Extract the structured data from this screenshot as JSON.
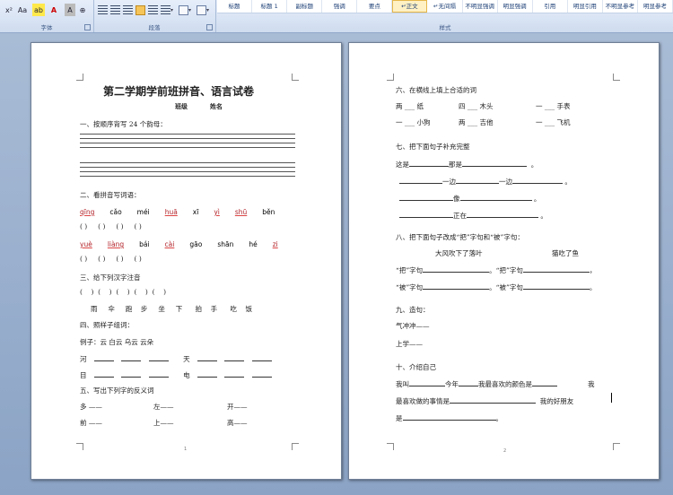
{
  "ribbon": {
    "font_group_label": "字体",
    "para_group_label": "段落",
    "style_group_label": "样式",
    "font_tools": [
      "x²",
      "Aa",
      "ab",
      "A",
      "A",
      "⊕"
    ],
    "styles": [
      "标题",
      "标题 1",
      "副标题",
      "强调",
      "要点",
      "↵正文",
      "↵无间隔",
      "不明显强调",
      "明显强调",
      "引用",
      "明显引用",
      "不明显参考",
      "明显参考"
    ]
  },
  "page1": {
    "title": "第二学期学前班拼音、语言试卷",
    "class_label": "班级",
    "name_label": "姓名",
    "q1": "一、按顺序背写 24 个韵母：",
    "q2": "二、看拼音写词语：",
    "pinyin_row1": [
      "qīng",
      "cǎo",
      "méi",
      "huā",
      "xī",
      "yì",
      "shū",
      "běn"
    ],
    "pinyin_row2": [
      "yuè",
      "liàng",
      "bái",
      "cài",
      "gāo",
      "shān",
      "hé",
      "zi"
    ],
    "paren": "(        )",
    "q3": "三、给下列汉字注音",
    "q3_chars": [
      "雨",
      "伞",
      "跑",
      "步",
      "坐",
      "下",
      "拍",
      "手",
      "吃",
      "饭"
    ],
    "q4": "四、照样子组词：",
    "q4_example": "例子：云  白云  乌云  云朵",
    "q4_chars": [
      "河",
      "天",
      "目",
      "电"
    ],
    "q5": "五、写出下列字的反义词",
    "q5_pairs": [
      "多 ——",
      "左——",
      "开——",
      "前 ——",
      "上——",
      "高——"
    ],
    "page_number": "1"
  },
  "page2": {
    "q6": "六、在横线上填上合适的词",
    "q6_items": [
      "两 ___ 纸",
      "四 ___ 木头",
      "一 ___ 手表",
      "一 ___ 小狗",
      "两 ___ 吉他",
      "一 ___ 飞机"
    ],
    "q7": "七、把下面句子补充完整",
    "q7_items": [
      "这是",
      "那是",
      "。",
      "一边",
      "一边",
      "。",
      "像",
      "。",
      "正在",
      "。"
    ],
    "q8": "八、把下面句子改成“把”字句和“被”字句：",
    "q8_s1": "大风吹下了落叶",
    "q8_s2": "猫吃了鱼",
    "ba": "“把”字句",
    "bei": "“被”字句",
    "q9": "九、造句：",
    "q9_items": [
      "气冲冲——",
      "上学——"
    ],
    "q10": "十、介绍自己",
    "q10_l1a": "我叫",
    "q10_l1b": "今年",
    "q10_l1c": "我最喜欢的颜色是",
    "q10_l1d": "我",
    "q10_l2a": "最喜欢做的事情是",
    "q10_l2b": "我的好朋友",
    "q10_l3": "是",
    "page_number": "2"
  }
}
